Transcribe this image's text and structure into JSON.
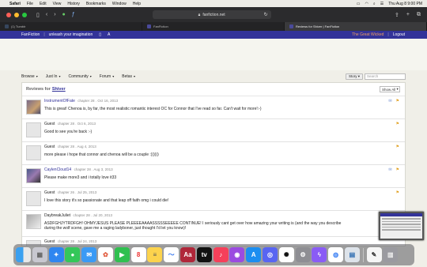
{
  "menubar": {
    "app": "Safari",
    "items": [
      "File",
      "Edit",
      "View",
      "History",
      "Bookmarks",
      "Window",
      "Help"
    ],
    "clock": "Thu Aug 8  9:00 PM"
  },
  "browser": {
    "url": "fanfiction.net",
    "tabs": [
      {
        "label": "(1) Tumblr",
        "active": false
      },
      {
        "label": "FanFiction",
        "active": false
      },
      {
        "label": "Reviews for Shiver | FanFiction",
        "active": true
      }
    ]
  },
  "site": {
    "brand": "FanFiction",
    "tagline": "unleash your imagination",
    "username": "The Great Wicked",
    "logout": "Logout",
    "nav": [
      "Browse",
      "Just In",
      "Community",
      "Forum",
      "Betas"
    ],
    "story_select": "Story",
    "search_placeholder": "Search"
  },
  "reviews_header": {
    "prefix": "Reviews for",
    "story": "Shiver",
    "filter": "Show All"
  },
  "reviews": [
    {
      "name": "InstrumentOfFate",
      "meta": "chapter 28 . Oct 16, 2013",
      "text": "This is great! Chenoa is, by far, the most realistic romantic interest OC for Connor that I've read so far. Can't wait for more!:-)",
      "linked": true,
      "avatar": "photo"
    },
    {
      "name": "Guest",
      "meta": "chapter 28 . Oct 6, 2013",
      "text": "Good to see you're back :-)",
      "linked": false,
      "avatar": "blank"
    },
    {
      "name": "Guest",
      "meta": "chapter 28 . Aug 4, 2013",
      "text": "more please i hope that connor and chenoa will be a couple :))))))",
      "linked": false,
      "avatar": "blank"
    },
    {
      "name": "CaylenCloud14",
      "meta": "chapter 28 . Aug 3, 2013",
      "text": "Please make more3 and i totally love it33",
      "linked": true,
      "avatar": "photo2"
    },
    {
      "name": "Guest",
      "meta": "chapter 26 . Jul 25, 2013",
      "text": "I love this story it's so passionate and that leap off faith omg i could die!",
      "linked": false,
      "avatar": "blank"
    },
    {
      "name": "DaybreakJuliet",
      "meta": "chapter 28 . Jul 20, 2013",
      "text": "ASDFGHJYTRDFGH! OHMYJESUS PLEASE PLEEEEAAAASSSSSEEEEE CONTINUE! I seriously cant get over how amazing your writing is (and the way you describe",
      "text2": "during the wolf scene, gave me a raging ladyboner, just thought I'd let you know)!",
      "linked": false,
      "avatar": "photo3"
    },
    {
      "name": "Guest",
      "meta": "chapter 28 . Jul 24, 2013",
      "text": "",
      "linked": false,
      "avatar": "blank"
    }
  ],
  "dock_icons": [
    "finder-icon",
    "launchpad-icon",
    "safari-icon",
    "messages-icon",
    "mail-icon",
    "photos-icon",
    "facetime-icon",
    "calendar-icon",
    "notes-icon",
    "freeform-icon",
    "dictionary-icon",
    "appletv-icon",
    "music-icon",
    "podcasts-icon",
    "appstore-icon",
    "discord-icon",
    "chatgpt-icon",
    "settings-icon",
    "messenger-icon",
    "chrome-icon",
    "preview-icon",
    "textedit-icon",
    "trash-icon"
  ],
  "colors": {
    "ff_blue": "#333399",
    "username": "#f0a060",
    "flag": "#e0a020"
  }
}
